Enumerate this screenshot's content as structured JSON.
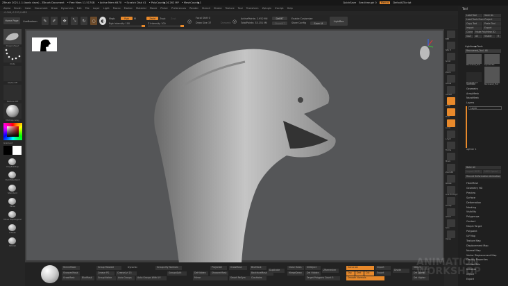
{
  "titlebar": {
    "title": "ZBrush 2021.1.1 (bonis dave) - ZBrush Document",
    "free_mem": "• Free Mem 11.517GB",
    "active_mem": "• Active Mem 6470",
    "scratch": "• Scratch Disk 41",
    "polycount": "• PolyCount▶24.262 MP",
    "meshcount": "• MeshCount▶1",
    "quicksave": "QuickSave",
    "seethrough": "See-through 0",
    "menus_btn": "Menus",
    "script": "DefaultZScript"
  },
  "menubar": [
    "Alpha",
    "Brush",
    "Color",
    "Document",
    "Draw",
    "Dynamics",
    "Edit",
    "File",
    "Layer",
    "Light",
    "Macro",
    "Marker",
    "Material",
    "Movie",
    "Picker",
    "Preferences",
    "Render",
    "Stencil",
    "Stroke",
    "Texture",
    "Tool",
    "Transform",
    "Zplugin",
    "Zscript",
    "Help"
  ],
  "coords": "-0.046,-0.253,0.683",
  "toolbar": {
    "home_page": "Home Page",
    "lightbox_browser": "LiveBoolean",
    "edit": "Edit",
    "draw": "Draw",
    "move": "Move",
    "scale": "Scale",
    "rotate": "Rotate",
    "mrgb": "Mrgb",
    "rgb": "Rgb",
    "m": "M",
    "zadd": "Zadd",
    "zsub": "Zsub",
    "zcut": "Zcut",
    "rgb_intensity": "Rgb Intensity 100",
    "z_intensity": "Z Intensity 100",
    "focal_shift": "Focal Shift 0",
    "draw_size": "Draw Size 37",
    "dynamic": "Dynamic",
    "active_points": "ActivePoints: 2.952 Mil",
    "total_points": "TotalPoints: 33.151 Mil",
    "defmt": "DefMT",
    "sharemt": "ShareMT",
    "enable_customize": "Enable Customize",
    "store_config": "Store Config",
    "save_ui": "Save UI",
    "lightbox": "LightBox"
  },
  "left_shelf": {
    "brush_alpha": "DragonHead",
    "stroke": "Dots",
    "alpha": "Alpha Off",
    "texture": "Texture Off",
    "material": "MatCap Gray",
    "gradient": "Gradient",
    "brushes": [
      "ClayBuildup",
      "DamStandard",
      "Standard",
      "Move",
      "Move Topological",
      "Inflate",
      "hPolish"
    ]
  },
  "tool_panel": {
    "title": "Tool",
    "buttons": [
      "Load Tool",
      "Save As",
      "Load Tools From Project",
      "Copy Tool",
      "Paste Tool",
      "Import",
      "Export",
      "Clone",
      "Make PolyMesh3D",
      "GoZ",
      "All",
      "Visible",
      "R"
    ],
    "lightbox_tools": "Lightbox▶Tools",
    "current_tool": "Recovered_Tool. 48",
    "thumbs": [
      "Recovered_Tool",
      "Cylinder3D",
      "PolyMesh3D",
      "SimpleBrush",
      "Recovered_Tool"
    ],
    "sections_top": [
      "Subtool",
      "Geometry",
      "ArrayMesh",
      "NanoMesh",
      "Layers"
    ],
    "layer_label": "Layer",
    "layer_slider": "ughter 1",
    "bake_all": "Bake All",
    "import_mdd": "Import MDD",
    "mdd_speed": "MDD Speed",
    "record": "Record Deformation Animation",
    "sections": [
      "FiberMesh",
      "Geometry HD",
      "Preview",
      "Surface",
      "Deformation",
      "Masking",
      "Visibility",
      "Polygroups",
      "Contact",
      "Morph Target",
      "Polypaint",
      "UV Map",
      "Texture Map",
      "Displacement Map",
      "Normal Map",
      "Vector Displacement Map",
      "Display Properties",
      "Unified Skin",
      "Initialize",
      "Import",
      "Export"
    ]
  },
  "right_shelf": [
    "BPR",
    "SPix 3",
    "Scroll",
    "Zoom",
    "Actual",
    "AAHalf",
    "Persp",
    "Floor",
    "Local",
    "L.Sym",
    "Frame",
    "Move",
    "Zoom3D",
    "Rotate",
    "Line Fill PolyF",
    "Transp",
    "Ghost",
    "Solo",
    "Xpose"
  ],
  "bottom": {
    "col1": [
      "ShrinkMask",
      "SharpenMask",
      "GrowMask"
    ],
    "col1b": [
      "BlurMask"
    ],
    "col2": [
      "Group Masked",
      "Groups By Normals",
      "Crease PG",
      "GroupsSplit",
      "GroupVisible",
      "Auto Groups",
      "Auto Groups With UV"
    ],
    "creaseLvl": "CreaseLvl 15",
    "dynamic": "Dynamic",
    "col3": [
      "ProjectAll",
      "DelHidden",
      "SharpenMask",
      "Mirror",
      "Smart ReSym",
      "GrowMask",
      "BlurMask",
      "BackfaceMask",
      "ClosHoles"
    ],
    "col4": [
      "Duplicate",
      "Close Holes",
      "MergeDown",
      "Del Hidden",
      "SliObject",
      "ZRemesher",
      "Target Polygons Count 5"
    ],
    "orange": [
      "Generate",
      "Ssp",
      "Smt",
      "Cut",
      "Smooth Normals"
    ],
    "col5": [
      "Import",
      "Export",
      "Divide",
      "SDiv 5",
      "Del Lower",
      "Del Higher"
    ]
  },
  "watermark": "ANIMATION WORKSHOP"
}
